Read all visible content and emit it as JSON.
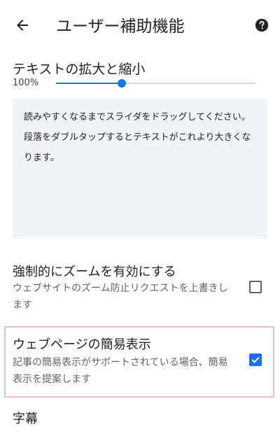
{
  "app_bar": {
    "title": "ユーザー補助機能",
    "back_icon": "arrow-back-icon",
    "help_icon": "help-circle-icon"
  },
  "text_scaling": {
    "title": "テキストの拡大と縮小",
    "value_label": "100%",
    "slider_fraction": 0.33,
    "preview_text": "読みやすくなるまでスライダをドラッグしてください。段落をダブルタップするとテキストがこれより大きくなります。"
  },
  "force_zoom": {
    "title": "強制的にズームを有効にする",
    "description": "ウェブサイトのズーム防止リクエストを上書きします",
    "checked": false
  },
  "simplified_view": {
    "title": "ウェブページの簡易表示",
    "description": "記事の簡易表示がサポートされている場合、簡易表示を提案します",
    "checked": true
  },
  "captions": {
    "title": "字幕"
  },
  "colors": {
    "accent": "#1a73e8",
    "highlight_border": "#f4b6cf",
    "preview_bg": "#f1f3f4"
  }
}
